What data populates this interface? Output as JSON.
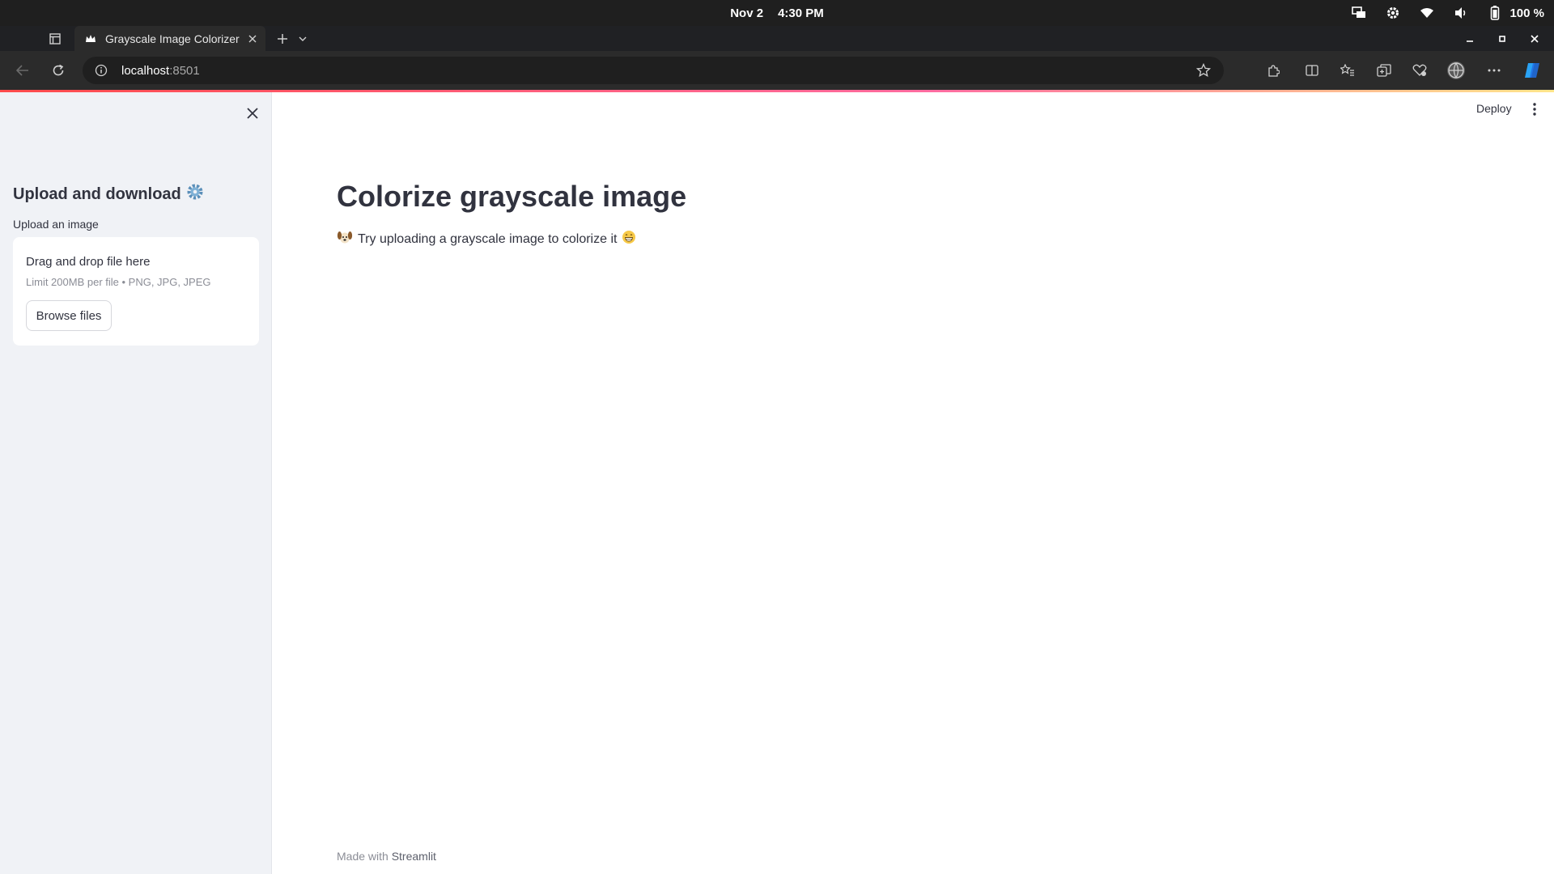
{
  "os": {
    "date": "Nov 2",
    "time": "4:30 PM",
    "battery": "100 %"
  },
  "browser": {
    "tab_title": "Grayscale Image Colorizer",
    "url_host": "localhost",
    "url_port": ":8501"
  },
  "sidebar": {
    "title": "Upload and download",
    "title_icon": "gear-emoji",
    "uploader_label": "Upload an image",
    "dropzone_text": "Drag and drop file here",
    "dropzone_limit": "Limit 200MB per file • PNG, JPG, JPEG",
    "browse_label": "Browse files"
  },
  "header": {
    "deploy_label": "Deploy"
  },
  "main": {
    "title": "Colorize grayscale image",
    "description": "Try uploading a grayscale image to colorize it",
    "description_lead_icon": "dog-face-emoji",
    "description_trail_icon": "grinning-face-emoji"
  },
  "footer": {
    "made_with": "Made with",
    "brand": "Streamlit"
  },
  "colors": {
    "text": "#31333f",
    "sidebar_bg": "#f0f2f6",
    "accent": "#ff4b4b"
  }
}
